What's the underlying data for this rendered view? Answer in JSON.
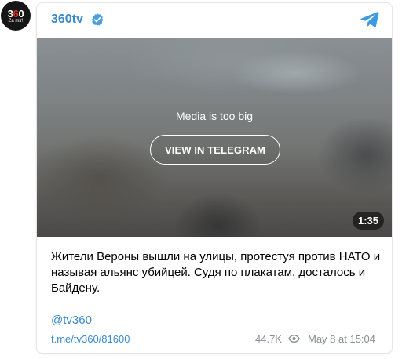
{
  "avatar": {
    "logo_number": "360",
    "logo_subtitle": "Za mir!"
  },
  "header": {
    "channel_name": "360tv",
    "verified_icon": "verified-badge-icon",
    "telegram_icon": "telegram-paper-plane-icon"
  },
  "media": {
    "message": "Media is too big",
    "button_label": "VIEW IN TELEGRAM",
    "duration": "1:35"
  },
  "post": {
    "text": "Жители Вероны вышли на улицы, протестуя против НАТО и называя альянс убийцей. Судя по плакатам, досталось и Байдену.",
    "mention": "@tv360",
    "link": "t.me/tv360/81600",
    "views": "44.7K",
    "views_icon": "eye-icon",
    "date": "May 8 at 15:04"
  },
  "colors": {
    "link_blue": "#3a89c9",
    "meta_gray": "#8a8f94",
    "verified_blue": "#4a9fe0",
    "telegram_blue": "#3d9ae0"
  }
}
